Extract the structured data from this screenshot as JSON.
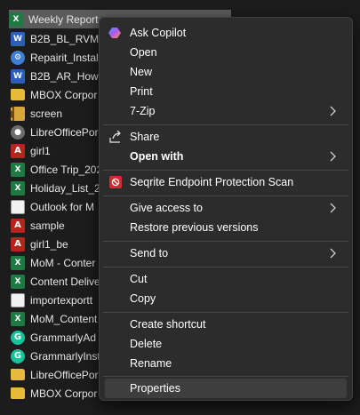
{
  "files": [
    {
      "name": "Weekly Report",
      "icon": "excel-icon"
    },
    {
      "name": "B2B_BL_RVMP",
      "icon": "word-icon"
    },
    {
      "name": "Repairit_Install",
      "icon": "setup-icon"
    },
    {
      "name": "B2B_AR_How t",
      "icon": "word-icon"
    },
    {
      "name": "MBOX Corpor",
      "icon": "folder-icon"
    },
    {
      "name": "screen",
      "icon": "zip-folder-icon"
    },
    {
      "name": "LibreOfficePor",
      "icon": "libreoffice-icon"
    },
    {
      "name": "girl1",
      "icon": "acrobat-icon"
    },
    {
      "name": "Office Trip_202",
      "icon": "excel-icon"
    },
    {
      "name": "Holiday_List_2",
      "icon": "excel-icon"
    },
    {
      "name": "Outlook for M",
      "icon": "document-icon"
    },
    {
      "name": "sample",
      "icon": "acrobat-icon"
    },
    {
      "name": "girl1_be",
      "icon": "acrobat-icon"
    },
    {
      "name": "MoM - Conter",
      "icon": "excel-icon"
    },
    {
      "name": "Content Delive",
      "icon": "excel-icon"
    },
    {
      "name": "importexportt",
      "icon": "document-icon"
    },
    {
      "name": "MoM_Content",
      "icon": "excel-icon"
    },
    {
      "name": "GrammarlyAd",
      "icon": "grammarly-icon"
    },
    {
      "name": "GrammarlyInst",
      "icon": "grammarly-icon"
    },
    {
      "name": "LibreOfficePor",
      "icon": "folder-icon"
    },
    {
      "name": "MBOX Corpor",
      "icon": "folder-icon"
    }
  ],
  "menu": {
    "ask_copilot": "Ask Copilot",
    "open": "Open",
    "new": "New",
    "print": "Print",
    "seven_zip": "7-Zip",
    "share": "Share",
    "open_with": "Open with",
    "seqrite": "Seqrite Endpoint Protection Scan",
    "give_access": "Give access to",
    "restore_previous": "Restore previous versions",
    "send_to": "Send to",
    "cut": "Cut",
    "copy": "Copy",
    "create_shortcut": "Create shortcut",
    "delete": "Delete",
    "rename": "Rename",
    "properties": "Properties"
  },
  "colors": {
    "background": "#1c1c1c",
    "menu_background": "#2c2c2c",
    "selected_row": "#5b5b5b",
    "hover_item": "#3e3e3e"
  }
}
